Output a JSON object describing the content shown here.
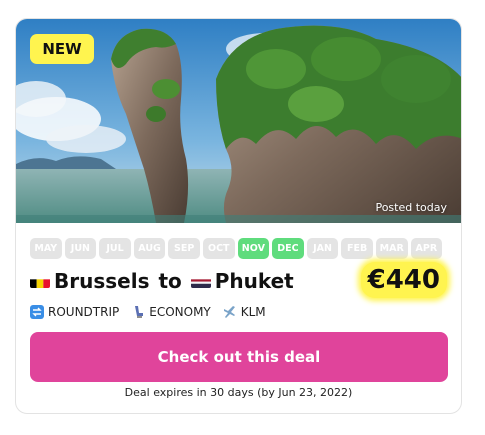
{
  "badge": {
    "label": "NEW"
  },
  "hero": {
    "posted_label": "Posted today"
  },
  "months": [
    {
      "label": "MAY",
      "active": false
    },
    {
      "label": "JUN",
      "active": false
    },
    {
      "label": "JUL",
      "active": false
    },
    {
      "label": "AUG",
      "active": false
    },
    {
      "label": "SEP",
      "active": false
    },
    {
      "label": "OCT",
      "active": false
    },
    {
      "label": "NOV",
      "active": true
    },
    {
      "label": "DEC",
      "active": true
    },
    {
      "label": "JAN",
      "active": false
    },
    {
      "label": "FEB",
      "active": false
    },
    {
      "label": "MAR",
      "active": false
    },
    {
      "label": "APR",
      "active": false
    }
  ],
  "route": {
    "origin": "Brussels",
    "connector": " to ",
    "destination": "Phuket",
    "origin_flag_icon": "belgium-flag-icon",
    "destination_flag_icon": "thailand-flag-icon"
  },
  "price": {
    "label": "€440"
  },
  "meta": {
    "trip_type": "ROUNDTRIP",
    "cabin": "ECONOMY",
    "airline": "KLM"
  },
  "cta": {
    "label": "Check out this deal"
  },
  "expires": {
    "label": "Deal expires in 30 days (by Jun 23, 2022)"
  },
  "colors": {
    "accent": "#e0449b",
    "highlight": "#fff44f",
    "month_active": "#5fdc7d",
    "month_inactive": "#e4e4e4"
  }
}
